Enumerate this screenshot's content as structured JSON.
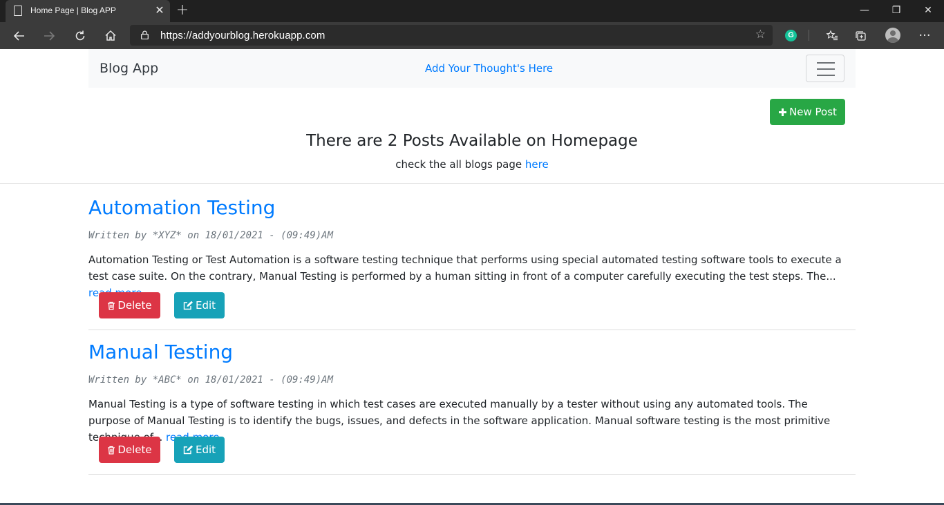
{
  "browser": {
    "tab_title": "Home Page | Blog APP",
    "tab_close": "✕",
    "new_tab": "+",
    "url": "https://addyourblog.herokuapp.com",
    "window_controls": {
      "minimize": "—",
      "maximize": "❐",
      "close": "✕"
    },
    "toolbar_icons": [
      "back-icon",
      "forward-icon",
      "refresh-icon",
      "home-icon",
      "lock-icon",
      "favorite-star-icon",
      "grammarly-icon",
      "favorites-icon",
      "collections-icon",
      "profile-avatar",
      "more-icon"
    ],
    "grammarly_letter": "G",
    "more": "···"
  },
  "navbar": {
    "brand": "Blog App",
    "link": "Add Your Thought's Here"
  },
  "actions": {
    "new_post": "New Post"
  },
  "header": {
    "title": "There are 2 Posts Available on Homepage",
    "subtitle_prefix": "check the all blogs page ",
    "subtitle_link": "here"
  },
  "posts": [
    {
      "title": "Automation Testing",
      "meta": "Written by *XYZ* on 18/01/2021 - (09:49)AM",
      "body": "Automation Testing or Test Automation is a software testing technique that performs using special automated testing software tools to execute a test case suite. On the contrary, Manual Testing is performed by a human sitting in front of a computer carefully executing the test steps. The...",
      "read_more": "read more",
      "delete_label": "Delete",
      "edit_label": "Edit"
    },
    {
      "title": "Manual Testing",
      "meta": "Written by *ABC* on 18/01/2021 - (09:49)AM",
      "body": "Manual Testing is a type of software testing in which test cases are executed manually by a tester without using any automated tools. The purpose of Manual Testing is to identify the bugs, issues, and defects in the software application. Manual software testing is the most primitive technique of...",
      "read_more": "read more",
      "delete_label": "Delete",
      "edit_label": "Edit"
    }
  ],
  "colors": {
    "primary": "#007bff",
    "success": "#28a745",
    "danger": "#dc3545",
    "info": "#17a2b8",
    "navbar_bg": "#f8f9fa"
  }
}
